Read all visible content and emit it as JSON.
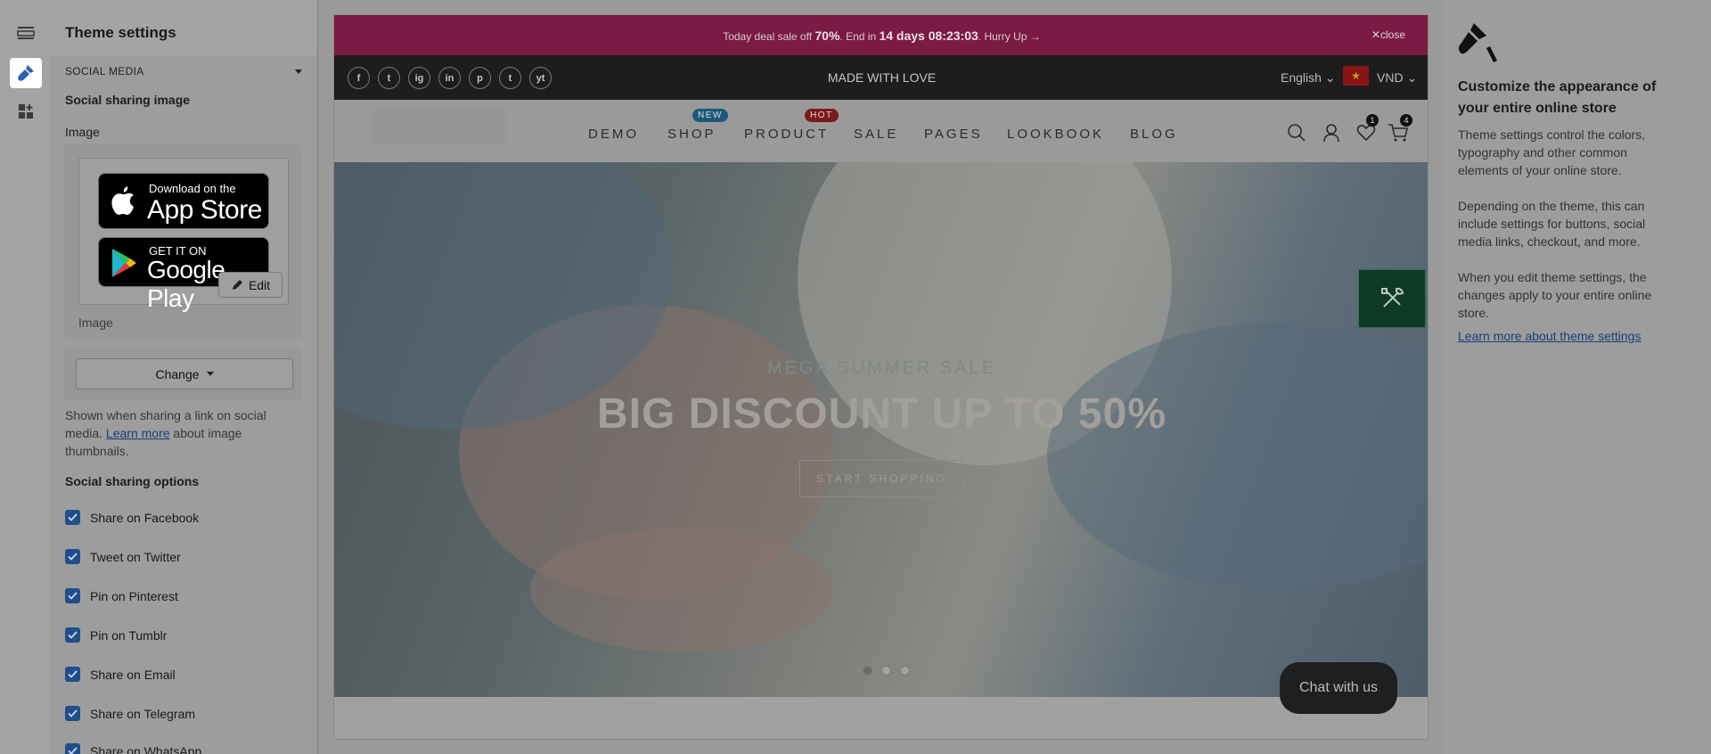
{
  "panel": {
    "title": "Theme settings",
    "section": "SOCIAL MEDIA",
    "sharing_image_heading": "Social sharing image",
    "image_label": "Image",
    "badge_apple_small": "Download on the",
    "badge_apple_big": "App Store",
    "badge_google_small": "GET IT ON",
    "badge_google_big": "Google Play",
    "edit_label": "Edit",
    "image_caption": "Image",
    "change_label": "Change",
    "help_prefix": "Shown when sharing a link on social media.",
    "help_link": "Learn more",
    "help_suffix": "about image thumbnails.",
    "options_heading": "Social sharing options",
    "options": [
      {
        "label": "Share on Facebook",
        "checked": true
      },
      {
        "label": "Tweet on Twitter",
        "checked": true
      },
      {
        "label": "Pin on Pinterest",
        "checked": true
      },
      {
        "label": "Pin on Tumblr",
        "checked": true
      },
      {
        "label": "Share on Email",
        "checked": true
      },
      {
        "label": "Share on Telegram",
        "checked": true
      },
      {
        "label": "Share on WhatsApp",
        "checked": true
      }
    ]
  },
  "rail": {
    "icons": [
      "sections-icon",
      "theme-settings-brush-icon",
      "app-blocks-icon"
    ],
    "active": "theme-settings-brush-icon"
  },
  "preview": {
    "announcement": {
      "pre": "Today deal sale off",
      "percent": "70%",
      "mid": ". End in",
      "countdown": "14 days 08:23:03",
      "post": ". Hurry Up →",
      "close": "close"
    },
    "social_icons": [
      "f",
      "t",
      "ig",
      "in",
      "p",
      "t",
      "yt"
    ],
    "tagline": "MADE WITH LOVE",
    "language": "English",
    "currency": "VND",
    "nav": [
      {
        "label": "DEMO",
        "badge": ""
      },
      {
        "label": "SHOP",
        "badge": "NEW"
      },
      {
        "label": "PRODUCT",
        "badge": "HOT"
      },
      {
        "label": "SALE",
        "badge": ""
      },
      {
        "label": "PAGES",
        "badge": ""
      },
      {
        "label": "LOOKBOOK",
        "badge": ""
      },
      {
        "label": "BLOG",
        "badge": ""
      }
    ],
    "wishlist_count": "1",
    "cart_count": "4",
    "hero": {
      "subtitle": "MEGA SUMMER SALE",
      "title": "BIG DISCOUNT UP TO 50%",
      "cta": "START SHOPPING",
      "slides": 3,
      "active_slide": 1
    },
    "chat": "Chat with us"
  },
  "info": {
    "title": "Customize the appearance of your entire online store",
    "p1": "Theme settings control the colors, typography and other common elements of your online store.",
    "p2": "Depending on the theme, this can include settings for buttons, social media links, checkout, and more.",
    "p3": "When you edit theme settings, the changes apply to your entire online store.",
    "link": "Learn more about theme settings"
  },
  "colors": {
    "accent": "#1f4f8a",
    "announcement_bar": "#7a1b43",
    "tool_button": "#0e3a25",
    "badge_new": "#1b5a78",
    "badge_hot": "#7a1a1a"
  }
}
